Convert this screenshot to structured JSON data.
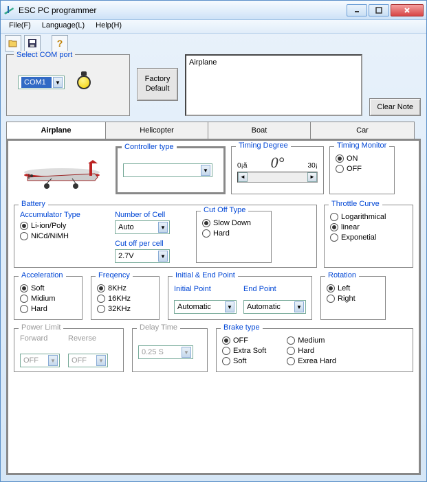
{
  "window": {
    "title": "ESC PC programmer"
  },
  "menu": {
    "file": "File(F)",
    "language": "Language(L)",
    "help": "Help(H)"
  },
  "com": {
    "label": "Select COM port",
    "value": "COM1"
  },
  "factory": {
    "line1": "Factory",
    "line2": "Default"
  },
  "note": {
    "text": "Airplane",
    "clear": "Clear Note"
  },
  "tabs": {
    "airplane": "Airplane",
    "helicopter": "Helicopter",
    "boat": "Boat",
    "car": "Car"
  },
  "controller": {
    "label": "Controller type",
    "value": ""
  },
  "timing": {
    "label": "Timing Degree",
    "min": "0¡ã",
    "max": "30¡",
    "value": "0°"
  },
  "monitor": {
    "label": "Timing Monitor",
    "on": "ON",
    "off": "OFF"
  },
  "battery": {
    "label": "Battery",
    "accum": {
      "label": "Accumulator Type",
      "opt1": "Li-ion/Poly",
      "opt2": "NiCd/NiMH"
    },
    "cells": {
      "label": "Number of Cell",
      "value": "Auto"
    },
    "cutoffper": {
      "label": "Cut off per cell",
      "value": "2.7V"
    },
    "cutofftype": {
      "label": "Cut Off Type",
      "opt1": "Slow Down",
      "opt2": "Hard"
    }
  },
  "throttle": {
    "label": "Throttle Curve",
    "opt1": "Logarithmical",
    "opt2": "linear",
    "opt3": "Exponetial"
  },
  "accel": {
    "label": "Acceleration",
    "opt1": "Soft",
    "opt2": "Midium",
    "opt3": "Hard"
  },
  "freq": {
    "label": "Freqency",
    "opt1": "8KHz",
    "opt2": "16KHz",
    "opt3": "32KHz"
  },
  "iep": {
    "label": "Initial & End Point",
    "initlabel": "Initial Point",
    "endlabel": "End Point",
    "initval": "Automatic",
    "endval": "Automatic"
  },
  "rotation": {
    "label": "Rotation",
    "opt1": "Left",
    "opt2": "Right"
  },
  "power": {
    "label": "Power Limit",
    "fwd": "Forward",
    "rev": "Reverse",
    "fwdval": "OFF",
    "revval": "OFF"
  },
  "delay": {
    "label": "Delay Time",
    "value": "0.25 S"
  },
  "brake": {
    "label": "Brake type",
    "opt1": "OFF",
    "opt2": "Extra Soft",
    "opt3": "Soft",
    "opt4": "Medium",
    "opt5": "Hard",
    "opt6": "Exrea Hard"
  }
}
